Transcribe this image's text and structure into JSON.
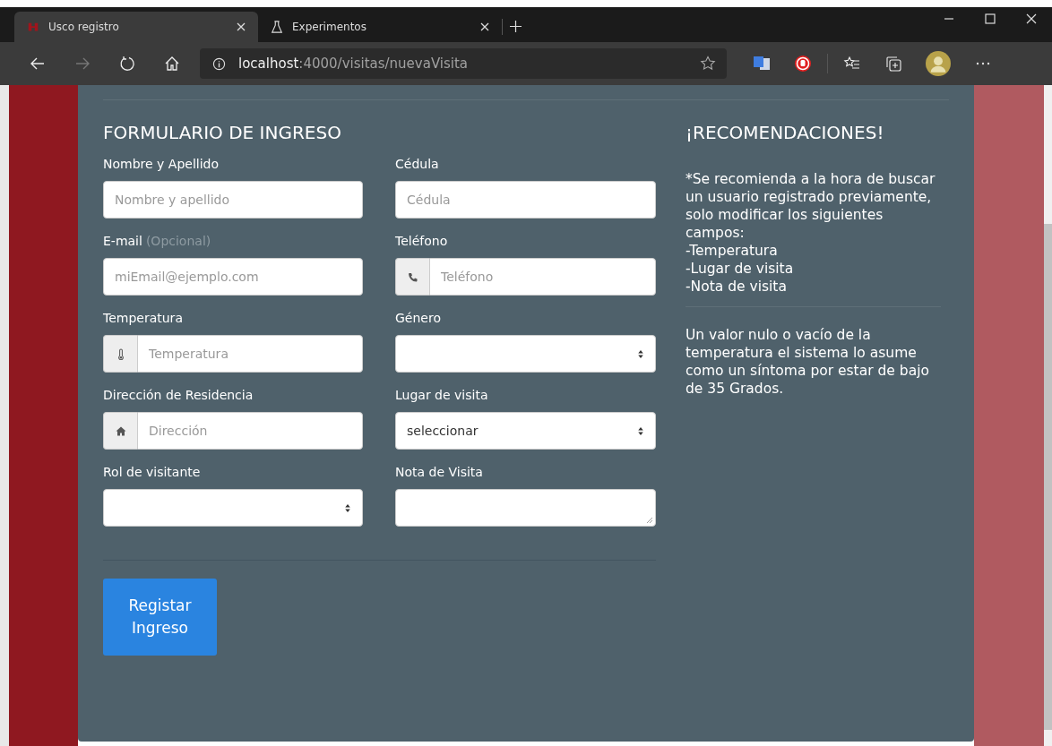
{
  "browser": {
    "tabs": [
      {
        "title": "Usco registro",
        "selected": true,
        "kind": "site"
      },
      {
        "title": "Experimentos",
        "selected": false,
        "kind": "flask"
      }
    ],
    "url": {
      "host": "localhost",
      "path": ":4000/visitas/nuevaVisita"
    }
  },
  "form": {
    "title": "FORMULARIO DE INGRESO",
    "fields": [
      {
        "label": "Nombre y Apellido",
        "kind": "text",
        "placeholder": "Nombre y apellido"
      },
      {
        "label": "Cédula",
        "kind": "text",
        "placeholder": "Cédula"
      },
      {
        "label": "E-mail",
        "hint": "(Opcional)",
        "kind": "text",
        "placeholder": "miEmail@ejemplo.com"
      },
      {
        "label": "Teléfono",
        "kind": "phone",
        "placeholder": "Teléfono"
      },
      {
        "label": "Temperatura",
        "kind": "thermometer",
        "placeholder": "Temperatura"
      },
      {
        "label": "Género",
        "kind": "select"
      },
      {
        "label": "Dirección de Residencia",
        "kind": "home",
        "placeholder": "Dirección"
      },
      {
        "label": "Lugar de visita",
        "kind": "select",
        "value": "seleccionar"
      },
      {
        "label": "Rol de visitante",
        "kind": "select"
      },
      {
        "label": "Nota de Visita",
        "kind": "textarea"
      }
    ],
    "submit": "Registar Ingreso"
  },
  "recommendations": {
    "title": "¡RECOMENDACIONES!",
    "lines": [
      "*Se recomienda a la hora de buscar un usuario registrado previamente, solo modificar los siguientes campos:",
      "-Temperatura",
      "-Lugar de visita",
      "-Nota de visita"
    ],
    "note": "Un valor nulo o vacío de la temperatura el sistema lo asume como un síntoma por estar de bajo de 35 Grados."
  }
}
